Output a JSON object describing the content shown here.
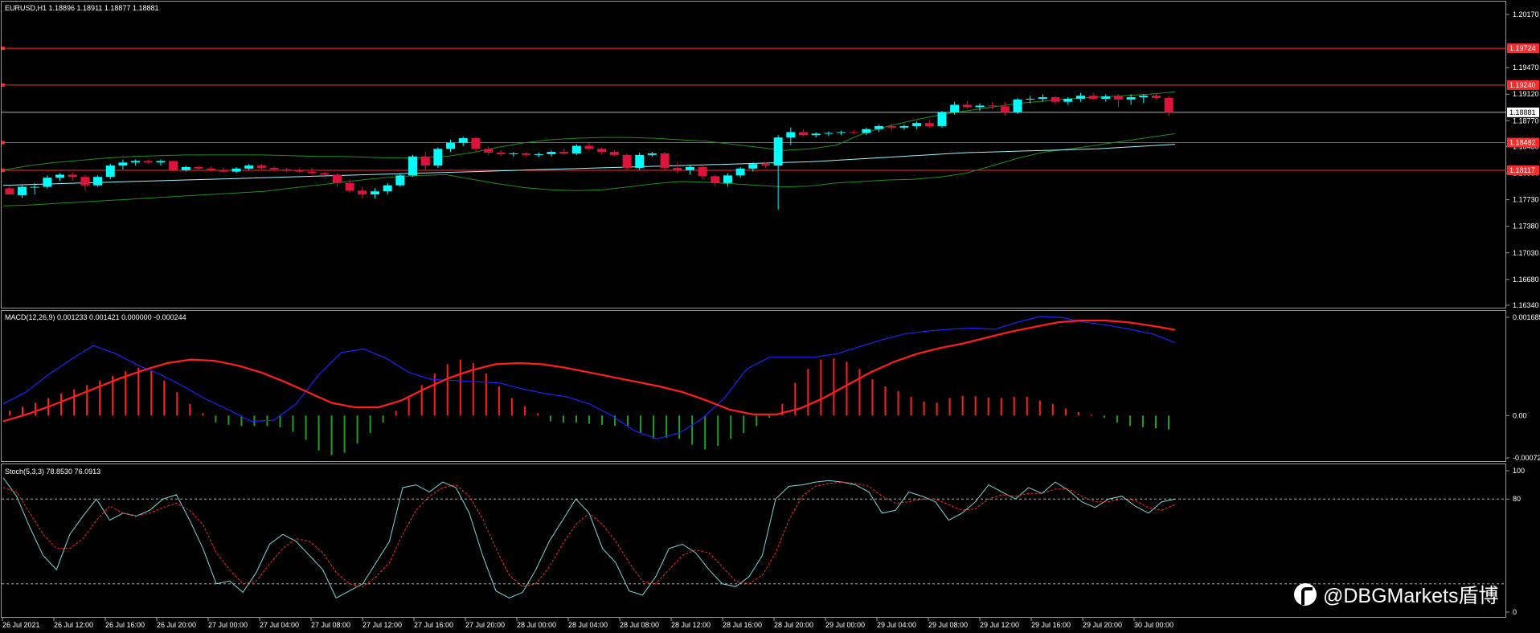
{
  "header": {
    "symbol_line": "EURUSD,H1  1.18896 1.18911 1.18877 1.18881",
    "macd_line": "MACD(12,26,9) 0.001233 0.001421 0.000000 -0.000244",
    "stoch_line": "Stoch(5,3,3) 78.8530 76.0913"
  },
  "watermark": {
    "text": "@DBGMarkets盾博",
    "logo": "weibo-logo-icon"
  },
  "colors": {
    "bull": "#00ffff",
    "bear": "#dc143c",
    "band": "#1f8f1f",
    "ma": "#9ef2ff",
    "hline": "#ff2a2a",
    "macd_signal": "#ff1f1f",
    "macd_main": "#2020ff",
    "hist_pos": "#ff1f1f",
    "hist_neg": "#1fa01f",
    "stoch_main": "#7fd8d8",
    "stoch_signal": "#ff2a2a"
  },
  "chart_data": [
    {
      "type": "candlestick",
      "symbol": "EURUSD",
      "timeframe": "H1",
      "ylim": [
        1.1634,
        1.2017
      ],
      "y_ticks": [
        "1.20170",
        "1.19470",
        "1.19120",
        "1.18770",
        "1.18430",
        "1.18080",
        "1.17730",
        "1.17380",
        "1.17030",
        "1.16680",
        "1.16340"
      ],
      "current_price_label": "1.18881",
      "current_price": 1.18881,
      "horizontal_lines": [
        {
          "value": 1.19724,
          "label": "1.19724"
        },
        {
          "value": 1.1924,
          "label": "1.19240"
        },
        {
          "value": 1.18482,
          "label": "1.18482"
        },
        {
          "value": 1.18117,
          "label": "1.18117"
        }
      ],
      "x_labels": [
        "26 Jul 2021",
        "26 Jul 12:00",
        "26 Jul 16:00",
        "26 Jul 20:00",
        "27 Jul 00:00",
        "27 Jul 04:00",
        "27 Jul 08:00",
        "27 Jul 12:00",
        "27 Jul 16:00",
        "27 Jul 20:00",
        "28 Jul 00:00",
        "28 Jul 04:00",
        "28 Jul 08:00",
        "28 Jul 12:00",
        "28 Jul 16:00",
        "28 Jul 20:00",
        "29 Jul 00:00",
        "29 Jul 04:00",
        "29 Jul 08:00",
        "29 Jul 12:00",
        "29 Jul 16:00",
        "29 Jul 20:00",
        "30 Jul 00:00"
      ],
      "candles": [
        [
          1.1788,
          1.1792,
          1.1782,
          1.178
        ],
        [
          1.1779,
          1.1792,
          1.1775,
          1.179
        ],
        [
          1.1789,
          1.1795,
          1.178,
          1.179
        ],
        [
          1.179,
          1.1805,
          1.1788,
          1.1802
        ],
        [
          1.1802,
          1.1808,
          1.1798,
          1.1806
        ],
        [
          1.1806,
          1.1809,
          1.1798,
          1.1803
        ],
        [
          1.1803,
          1.1806,
          1.1785,
          1.1792
        ],
        [
          1.1792,
          1.1805,
          1.179,
          1.1803
        ],
        [
          1.1803,
          1.182,
          1.18,
          1.1818
        ],
        [
          1.1818,
          1.1826,
          1.1813,
          1.1822
        ],
        [
          1.1822,
          1.1826,
          1.1818,
          1.1824
        ],
        [
          1.1824,
          1.1826,
          1.182,
          1.1822
        ],
        [
          1.1822,
          1.1826,
          1.1818,
          1.1824
        ],
        [
          1.1824,
          1.1824,
          1.181,
          1.1812
        ],
        [
          1.1812,
          1.1818,
          1.181,
          1.1816
        ],
        [
          1.1816,
          1.1818,
          1.1813,
          1.1814
        ],
        [
          1.1814,
          1.1817,
          1.181,
          1.1812
        ],
        [
          1.1812,
          1.1815,
          1.1809,
          1.181
        ],
        [
          1.181,
          1.1816,
          1.1808,
          1.1814
        ],
        [
          1.1814,
          1.182,
          1.1812,
          1.1818
        ],
        [
          1.1818,
          1.182,
          1.1813,
          1.1815
        ],
        [
          1.1815,
          1.1817,
          1.1811,
          1.1813
        ],
        [
          1.1813,
          1.1815,
          1.181,
          1.1812
        ],
        [
          1.1812,
          1.1814,
          1.1809,
          1.181
        ],
        [
          1.181,
          1.1815,
          1.1806,
          1.1808
        ],
        [
          1.1808,
          1.181,
          1.1802,
          1.1806
        ],
        [
          1.1806,
          1.1808,
          1.179,
          1.1795
        ],
        [
          1.1795,
          1.18,
          1.1782,
          1.1785
        ],
        [
          1.1785,
          1.179,
          1.1775,
          1.178
        ],
        [
          1.178,
          1.1788,
          1.1775,
          1.1784
        ],
        [
          1.1784,
          1.1795,
          1.178,
          1.1792
        ],
        [
          1.1792,
          1.1808,
          1.179,
          1.1805
        ],
        [
          1.1805,
          1.1832,
          1.1803,
          1.183
        ],
        [
          1.183,
          1.1836,
          1.1812,
          1.1818
        ],
        [
          1.1818,
          1.1842,
          1.1815,
          1.184
        ],
        [
          1.184,
          1.1852,
          1.1836,
          1.1848
        ],
        [
          1.1848,
          1.1856,
          1.1844,
          1.1854
        ],
        [
          1.1854,
          1.1856,
          1.1836,
          1.184
        ],
        [
          1.184,
          1.1843,
          1.1832,
          1.1835
        ],
        [
          1.1835,
          1.1838,
          1.183,
          1.1833
        ],
        [
          1.1833,
          1.1836,
          1.183,
          1.1834
        ],
        [
          1.1834,
          1.1836,
          1.183,
          1.1832
        ],
        [
          1.1832,
          1.1835,
          1.1829,
          1.1833
        ],
        [
          1.1833,
          1.1838,
          1.183,
          1.1836
        ],
        [
          1.1836,
          1.184,
          1.1832,
          1.1834
        ],
        [
          1.1834,
          1.1846,
          1.1832,
          1.1844
        ],
        [
          1.1844,
          1.1848,
          1.1838,
          1.184
        ],
        [
          1.184,
          1.1842,
          1.1832,
          1.1836
        ],
        [
          1.1836,
          1.1838,
          1.183,
          1.1832
        ],
        [
          1.1832,
          1.1834,
          1.1812,
          1.1815
        ],
        [
          1.1815,
          1.1835,
          1.1812,
          1.1832
        ],
        [
          1.1832,
          1.1836,
          1.183,
          1.1834
        ],
        [
          1.1834,
          1.1836,
          1.1812,
          1.1815
        ],
        [
          1.1815,
          1.1822,
          1.1808,
          1.1812
        ],
        [
          1.1812,
          1.1818,
          1.1806,
          1.1816
        ],
        [
          1.1816,
          1.1818,
          1.18,
          1.1804
        ],
        [
          1.1804,
          1.1806,
          1.179,
          1.1795
        ],
        [
          1.1795,
          1.1808,
          1.179,
          1.1805
        ],
        [
          1.1805,
          1.1816,
          1.1802,
          1.1814
        ],
        [
          1.1814,
          1.1822,
          1.181,
          1.182
        ],
        [
          1.182,
          1.1822,
          1.1815,
          1.1818
        ],
        [
          1.1818,
          1.1858,
          1.176,
          1.1855
        ],
        [
          1.1855,
          1.1868,
          1.1845,
          1.1862
        ],
        [
          1.1862,
          1.1866,
          1.1856,
          1.1858
        ],
        [
          1.1858,
          1.1862,
          1.1855,
          1.186
        ],
        [
          1.186,
          1.1863,
          1.1857,
          1.1861
        ],
        [
          1.1861,
          1.1864,
          1.1858,
          1.1862
        ],
        [
          1.1862,
          1.1865,
          1.1859,
          1.1861
        ],
        [
          1.1861,
          1.1868,
          1.1858,
          1.1866
        ],
        [
          1.1866,
          1.1872,
          1.1862,
          1.187
        ],
        [
          1.187,
          1.1873,
          1.1864,
          1.1868
        ],
        [
          1.1868,
          1.1872,
          1.1865,
          1.187
        ],
        [
          1.187,
          1.1876,
          1.1866,
          1.1874
        ],
        [
          1.1874,
          1.1878,
          1.1868,
          1.187
        ],
        [
          1.187,
          1.189,
          1.1868,
          1.1888
        ],
        [
          1.1888,
          1.1902,
          1.1885,
          1.1898
        ],
        [
          1.1898,
          1.1903,
          1.1893,
          1.1895
        ],
        [
          1.1895,
          1.19,
          1.189,
          1.1897
        ],
        [
          1.1897,
          1.1902,
          1.1892,
          1.1896
        ],
        [
          1.1896,
          1.1902,
          1.1884,
          1.1888
        ],
        [
          1.1888,
          1.1907,
          1.1886,
          1.1905
        ],
        [
          1.1905,
          1.191,
          1.19,
          1.1906
        ],
        [
          1.1906,
          1.1912,
          1.1902,
          1.1908
        ],
        [
          1.1908,
          1.191,
          1.1898,
          1.1902
        ],
        [
          1.1902,
          1.1908,
          1.1898,
          1.1906
        ],
        [
          1.1906,
          1.1914,
          1.1902,
          1.191
        ],
        [
          1.191,
          1.1914,
          1.1904,
          1.1906
        ],
        [
          1.1906,
          1.1912,
          1.1902,
          1.1909
        ],
        [
          1.1909,
          1.1912,
          1.1895,
          1.1905
        ],
        [
          1.1905,
          1.1912,
          1.1898,
          1.1908
        ],
        [
          1.1908,
          1.1912,
          1.19,
          1.191
        ],
        [
          1.191,
          1.1913,
          1.1905,
          1.1907
        ],
        [
          1.1907,
          1.191,
          1.1883,
          1.1888
        ]
      ],
      "bollinger_upper": [
        1.1812,
        1.1818,
        1.1822,
        1.1825,
        1.1828,
        1.183,
        1.1831,
        1.1832,
        1.1832,
        1.1832,
        1.1832,
        1.1831,
        1.183,
        1.183,
        1.1829,
        1.1828,
        1.1828,
        1.183,
        1.1835,
        1.1842,
        1.1848,
        1.1852,
        1.1854,
        1.1855,
        1.1855,
        1.1854,
        1.1852,
        1.185,
        1.1846,
        1.1842,
        1.1838,
        1.184,
        1.1845,
        1.186,
        1.187,
        1.1878,
        1.1885,
        1.189,
        1.1895,
        1.19,
        1.1903,
        1.1906,
        1.1908,
        1.191,
        1.1912,
        1.1915
      ],
      "bollinger_lower": [
        1.1765,
        1.1766,
        1.1768,
        1.177,
        1.1772,
        1.1774,
        1.1776,
        1.1778,
        1.178,
        1.1782,
        1.1784,
        1.1788,
        1.1792,
        1.1796,
        1.18,
        1.1803,
        1.1805,
        1.1806,
        1.18,
        1.1794,
        1.1789,
        1.1786,
        1.1785,
        1.1786,
        1.179,
        1.1794,
        1.1797,
        1.1796,
        1.1794,
        1.1792,
        1.179,
        1.1791,
        1.1795,
        1.1797,
        1.1799,
        1.18,
        1.1803,
        1.1808,
        1.1818,
        1.1828,
        1.1836,
        1.184,
        1.1845,
        1.185,
        1.1855,
        1.186
      ],
      "moving_average": [
        1.1792,
        1.1793,
        1.1794,
        1.1795,
        1.1796,
        1.1797,
        1.1798,
        1.1799,
        1.18,
        1.1801,
        1.1802,
        1.1803,
        1.1804,
        1.1805,
        1.1806,
        1.1807,
        1.1808,
        1.1809,
        1.181,
        1.1811,
        1.1812,
        1.1813,
        1.1814,
        1.1815,
        1.1816,
        1.1817,
        1.1818,
        1.1819,
        1.182,
        1.1821,
        1.1822,
        1.1823,
        1.1825,
        1.1827,
        1.1829,
        1.1831,
        1.1833,
        1.1835,
        1.1836,
        1.1837,
        1.1838,
        1.1839,
        1.184,
        1.1842,
        1.1844,
        1.1846
      ]
    },
    {
      "type": "bar",
      "name": "MACD(12,26,9)",
      "ylim": [
        -0.000727,
        0.001685
      ],
      "y_ticks": [
        "0.001685",
        "0.00",
        "-0.000727"
      ],
      "histogram": [
        8e-05,
        0.00015,
        0.00022,
        0.0003,
        0.00038,
        0.00045,
        0.00052,
        0.0006,
        0.00068,
        0.00076,
        0.00082,
        0.00076,
        0.0006,
        0.0004,
        0.0002,
        4e-05,
        -0.00012,
        -0.00016,
        -0.00018,
        -0.00018,
        -0.00018,
        -0.0002,
        -0.00028,
        -0.00042,
        -0.0006,
        -0.00068,
        -0.00064,
        -0.00048,
        -0.0003,
        -0.00012,
        8e-05,
        0.0003,
        0.00052,
        0.00072,
        0.00088,
        0.00096,
        0.0009,
        0.00072,
        0.0005,
        0.0003,
        0.00016,
        4e-05,
        -0.0001,
        -0.00012,
        -0.00012,
        -0.00014,
        -0.00016,
        -0.00018,
        -0.00018,
        -0.0003,
        -0.0004,
        -0.00038,
        -0.0004,
        -0.0005,
        -0.00058,
        -0.00052,
        -0.0004,
        -0.0003,
        -0.00018,
        -4e-05,
        0.0002,
        0.00056,
        0.0008,
        0.00096,
        0.00098,
        0.00092,
        0.0008,
        0.00062,
        0.0005,
        0.00042,
        0.00032,
        0.00024,
        0.00022,
        0.0003,
        0.00034,
        0.00033,
        0.00031,
        0.0003,
        0.00032,
        0.00032,
        0.00026,
        0.0002,
        0.00012,
        6e-05,
        2e-05,
        -4e-05,
        -0.00012,
        -0.00018,
        -0.0002,
        -0.00022,
        -0.00024
      ],
      "signal": [
        -0.0001,
        2e-05,
        0.00016,
        0.00032,
        0.00048,
        0.00064,
        0.00078,
        0.0009,
        0.00096,
        0.00094,
        0.00086,
        0.00074,
        0.00058,
        0.0004,
        0.00022,
        0.00014,
        0.00014,
        0.00026,
        0.00046,
        0.00064,
        0.00078,
        0.00088,
        0.0009,
        0.00088,
        0.00082,
        0.00074,
        0.00066,
        0.00058,
        0.0005,
        0.0004,
        0.00026,
        0.0001,
        2e-05,
        2e-05,
        0.00012,
        0.0003,
        0.00052,
        0.00074,
        0.00092,
        0.00106,
        0.00116,
        0.00124,
        0.00134,
        0.00144,
        0.00152,
        0.0016,
        0.00163,
        0.00163,
        0.0016,
        0.00154,
        0.00147
      ],
      "main": [
        0.0002,
        0.0004,
        0.0007,
        0.00096,
        0.0012,
        0.00106,
        0.00086,
        0.0007,
        0.0005,
        0.00028,
        0.0001,
        -0.0001,
        -8e-05,
        0.0002,
        0.0007,
        0.00108,
        0.00114,
        0.00098,
        0.00074,
        0.00062,
        0.0006,
        0.00058,
        0.00056,
        0.00046,
        0.00038,
        0.00032,
        0.0002,
        0.0,
        -0.00026,
        -0.0004,
        -0.0003,
        -6e-05,
        0.0003,
        0.0008,
        0.001,
        0.001,
        0.001,
        0.00106,
        0.00118,
        0.0013,
        0.0014,
        0.00145,
        0.00148,
        0.0015,
        0.00148,
        0.0016,
        0.0017,
        0.00168,
        0.0016,
        0.00155,
        0.00148,
        0.0014,
        0.00125
      ]
    },
    {
      "type": "line",
      "name": "Stoch(5,3,3)",
      "ylim": [
        0,
        100
      ],
      "y_ticks": [
        "100",
        "80",
        "0"
      ],
      "levels": [
        80,
        20
      ],
      "main": [
        95,
        82,
        60,
        40,
        30,
        55,
        68,
        80,
        65,
        70,
        68,
        72,
        80,
        83,
        65,
        45,
        20,
        22,
        14,
        28,
        48,
        55,
        50,
        40,
        30,
        10,
        15,
        20,
        35,
        50,
        88,
        90,
        85,
        92,
        88,
        70,
        40,
        15,
        10,
        14,
        30,
        50,
        65,
        80,
        70,
        45,
        35,
        15,
        12,
        25,
        45,
        48,
        42,
        30,
        20,
        18,
        25,
        40,
        80,
        89,
        90,
        92,
        93,
        92,
        90,
        85,
        70,
        72,
        85,
        82,
        78,
        65,
        70,
        78,
        90,
        85,
        80,
        88,
        84,
        92,
        86,
        78,
        74,
        80,
        82,
        75,
        70,
        78,
        80
      ],
      "signal": [
        88,
        85,
        70,
        55,
        45,
        45,
        52,
        65,
        75,
        70,
        68,
        70,
        74,
        77,
        72,
        62,
        42,
        30,
        20,
        22,
        34,
        45,
        52,
        50,
        42,
        28,
        20,
        18,
        25,
        35,
        55,
        72,
        82,
        88,
        90,
        82,
        66,
        45,
        26,
        18,
        20,
        32,
        48,
        62,
        70,
        62,
        50,
        35,
        22,
        20,
        30,
        40,
        44,
        42,
        32,
        22,
        20,
        26,
        42,
        65,
        82,
        89,
        91,
        92,
        91,
        89,
        82,
        77,
        78,
        80,
        80,
        76,
        72,
        73,
        80,
        83,
        82,
        84,
        84,
        87,
        87,
        82,
        78,
        78,
        80,
        79,
        74,
        72,
        76
      ]
    }
  ]
}
